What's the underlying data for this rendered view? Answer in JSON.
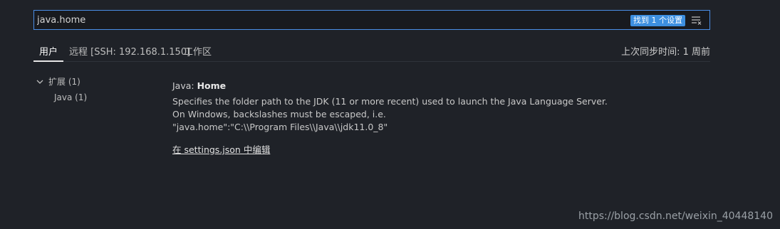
{
  "search": {
    "value": "java.home",
    "result_badge": "找到 1 个设置",
    "filter_icon": "filter-icon"
  },
  "tabs": [
    {
      "label": "用户",
      "active": true
    },
    {
      "label": "远程 [SSH: 192.168.1.150]",
      "active": false
    },
    {
      "label": "工作区",
      "active": false
    }
  ],
  "sync_status": "上次同步时间: 1 周前",
  "tree": {
    "group_label": "扩展 (1)",
    "child_label": "Java (1)"
  },
  "setting": {
    "category": "Java: ",
    "name": "Home",
    "description": [
      "Specifies the folder path to the JDK (11 or more recent) used to launch the Java Language Server.",
      "On Windows, backslashes must be escaped, i.e.",
      "\"java.home\":\"C:\\\\Program Files\\\\Java\\\\jdk11.0_8\""
    ],
    "edit_link": "在 settings.json 中编辑"
  },
  "watermark": "https://blog.csdn.net/weixin_40448140",
  "colors": {
    "background": "#1f2228",
    "accent": "#4a8ee6",
    "badge": "#3d8fe0"
  }
}
